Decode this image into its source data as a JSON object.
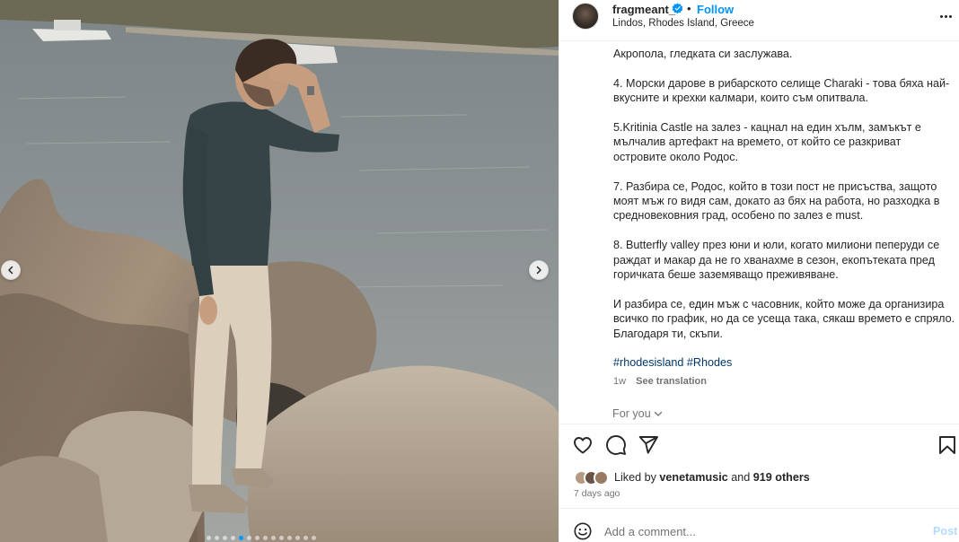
{
  "post": {
    "username": "fragmeant_",
    "follow_label": "Follow",
    "bullet": "•",
    "location": "Lindos, Rhodes Island, Greece"
  },
  "caption": {
    "paragraphs": [
      "Акропола, гледката си заслужава.",
      "4. Морски дарове в рибарското селище Charaki - това бяха най-вкусните и крехки калмари, които съм опитвала.",
      "5.Kritinia Castle на залез - кацнал на един хълм, замъкът е мълчалив артефакт на времето, от който се разкриват островите около Родос.",
      "7. Разбира се, Родос, който в този пост не присъства, защото моят мъж го видя сам, докато аз бях на работа, но разходка в средновековния град, особено по залез е must.",
      "8. Butterfly valley през юни и юли, когато милиони пеперуди се раждат и макар да не го хванахме в сезон, екопътеката пред горичката беше заземяващо преживяване.",
      "И разбира се, един мъж с часовник, който може да организира всичко по график, но да се усеща така, сякаш времето е спряло. Благодаря ти, скъпи."
    ],
    "hashtags": [
      "#rhodesisland",
      "#Rhodes"
    ],
    "time": "1w",
    "see_translation": "See translation"
  },
  "for_you": "For you",
  "likes": {
    "prefix": "Liked by ",
    "user": "venetamusic",
    "middle": " and ",
    "others": "919 others"
  },
  "posted": "7 days ago",
  "comment": {
    "placeholder": "Add a comment...",
    "post_label": "Post"
  },
  "carousel": {
    "total_slides": 14,
    "active_slide": 4
  },
  "icons": {
    "verified": "verified-badge-icon",
    "more": "more-options-icon",
    "like": "heart-icon",
    "comment": "comment-bubble-icon",
    "share": "paper-plane-icon",
    "save": "bookmark-icon",
    "emoji": "emoji-smiley-icon",
    "prev": "chevron-left-icon",
    "next": "chevron-right-icon",
    "for_you_chevron": "chevron-down-icon"
  },
  "colors": {
    "accent": "#0095f6",
    "link": "#00376b",
    "secondary_text": "#737373",
    "post_disabled": "#b3dbff"
  }
}
